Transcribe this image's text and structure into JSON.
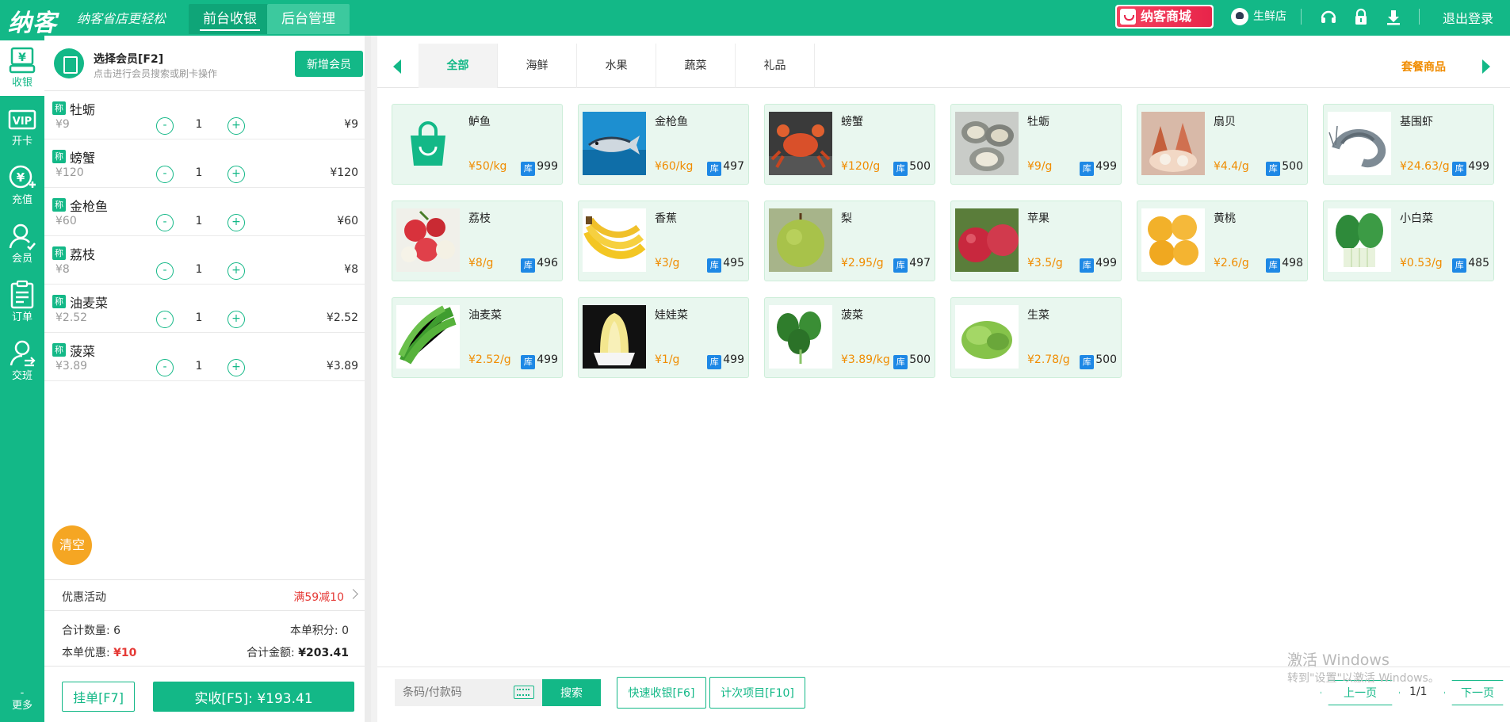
{
  "header": {
    "logo": "纳客",
    "slogan": "纳客省店更轻松",
    "tabs": [
      "前台收银",
      "后台管理"
    ],
    "mall_label": "纳客商城",
    "shop_name": "生鲜店",
    "logout_label": "退出登录"
  },
  "nav": {
    "items": [
      {
        "label": "收银",
        "icon": "cashier-icon"
      },
      {
        "label": "开卡",
        "icon": "vip-card-icon"
      },
      {
        "label": "充值",
        "icon": "recharge-icon"
      },
      {
        "label": "会员",
        "icon": "member-icon"
      },
      {
        "label": "订单",
        "icon": "order-icon"
      },
      {
        "label": "交班",
        "icon": "shift-icon"
      }
    ],
    "more_label": "更多"
  },
  "member": {
    "title": "选择会员[F2]",
    "hint": "点击进行会员搜索或刷卡操作",
    "add_label": "新增会员"
  },
  "cart": {
    "tag": "称",
    "items": [
      {
        "name": "牡蛎",
        "unit_price": "¥9",
        "qty": "1",
        "subtotal": "¥9"
      },
      {
        "name": "螃蟹",
        "unit_price": "¥120",
        "qty": "1",
        "subtotal": "¥120"
      },
      {
        "name": "金枪鱼",
        "unit_price": "¥60",
        "qty": "1",
        "subtotal": "¥60"
      },
      {
        "name": "荔枝",
        "unit_price": "¥8",
        "qty": "1",
        "subtotal": "¥8"
      },
      {
        "name": "油麦菜",
        "unit_price": "¥2.52",
        "qty": "1",
        "subtotal": "¥2.52"
      },
      {
        "name": "菠菜",
        "unit_price": "¥3.89",
        "qty": "1",
        "subtotal": "¥3.89"
      }
    ],
    "clear_label": "清空",
    "promo_label": "优惠活动",
    "promo_value": "满59减10",
    "total_qty_label": "合计数量:",
    "total_qty": "6",
    "points_label": "本单积分:",
    "points": "0",
    "discount_label": "本单优惠:",
    "discount": "¥10",
    "total_amount_label": "合计金额:",
    "total_amount": "¥203.41",
    "hold_label": "挂单[F7]",
    "pay_label": "实收[F5]: ¥193.41"
  },
  "categories": {
    "tabs": [
      "全部",
      "海鲜",
      "水果",
      "蔬菜",
      "礼品"
    ],
    "package_label": "套餐商品"
  },
  "stock_tag": "库",
  "products": [
    {
      "name": "鲈鱼",
      "price": "¥50/kg",
      "stock": "999",
      "thumb": "bag"
    },
    {
      "name": "金枪鱼",
      "price": "¥60/kg",
      "stock": "497",
      "thumb": "tuna"
    },
    {
      "name": "螃蟹",
      "price": "¥120/g",
      "stock": "500",
      "thumb": "crab"
    },
    {
      "name": "牡蛎",
      "price": "¥9/g",
      "stock": "499",
      "thumb": "oyster"
    },
    {
      "name": "扇贝",
      "price": "¥4.4/g",
      "stock": "500",
      "thumb": "scallop"
    },
    {
      "name": "基围虾",
      "price": "¥24.63/g",
      "stock": "499",
      "thumb": "shrimp"
    },
    {
      "name": "荔枝",
      "price": "¥8/g",
      "stock": "496",
      "thumb": "lychee"
    },
    {
      "name": "香蕉",
      "price": "¥3/g",
      "stock": "495",
      "thumb": "banana"
    },
    {
      "name": "梨",
      "price": "¥2.95/g",
      "stock": "497",
      "thumb": "pear"
    },
    {
      "name": "苹果",
      "price": "¥3.5/g",
      "stock": "499",
      "thumb": "apple"
    },
    {
      "name": "黄桃",
      "price": "¥2.6/g",
      "stock": "498",
      "thumb": "peach"
    },
    {
      "name": "小白菜",
      "price": "¥0.53/g",
      "stock": "485",
      "thumb": "bokchoy"
    },
    {
      "name": "油麦菜",
      "price": "¥2.52/g",
      "stock": "499",
      "thumb": "lettuce-stem"
    },
    {
      "name": "娃娃菜",
      "price": "¥1/g",
      "stock": "499",
      "thumb": "baby-cabbage"
    },
    {
      "name": "菠菜",
      "price": "¥3.89/kg",
      "stock": "500",
      "thumb": "spinach"
    },
    {
      "name": "生菜",
      "price": "¥2.78/g",
      "stock": "500",
      "thumb": "lettuce"
    }
  ],
  "bottom": {
    "search_placeholder": "条码/付款码",
    "search_label": "搜索",
    "quick_cash_label": "快速收银[F6]",
    "count_items_label": "计次项目[F10]",
    "prev_label": "上一页",
    "page_indicator": "1/1",
    "next_label": "下一页"
  },
  "watermark": {
    "line1": "激活 Windows",
    "line2": "转到\"设置\"以激活 Windows。"
  },
  "colors": {
    "brand": "#13b887",
    "price": "#f08c00",
    "promo": "#e53935",
    "stock_tag": "#1e88e5",
    "clear": "#f5a623"
  }
}
